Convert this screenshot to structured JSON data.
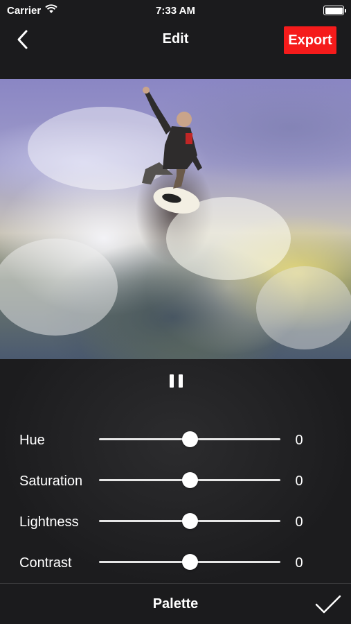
{
  "status_bar": {
    "carrier": "Carrier",
    "time": "7:33 AM",
    "icons": [
      "wifi-icon",
      "battery-icon"
    ]
  },
  "nav": {
    "title": "Edit",
    "back_icon": "chevron-left-icon",
    "export_label": "Export",
    "export_color": "#f51b1b"
  },
  "photo": {
    "alt_kind": "image-preview"
  },
  "playback": {
    "icon": "pause-icon"
  },
  "adjustments": [
    {
      "label": "Hue",
      "value": "0",
      "position": 0.5
    },
    {
      "label": "Saturation",
      "value": "0",
      "position": 0.5
    },
    {
      "label": "Lightness",
      "value": "0",
      "position": 0.5
    },
    {
      "label": "Contrast",
      "value": "0",
      "position": 0.5
    }
  ],
  "bottom": {
    "palette_label": "Palette",
    "done_icon": "checkmark-icon"
  }
}
